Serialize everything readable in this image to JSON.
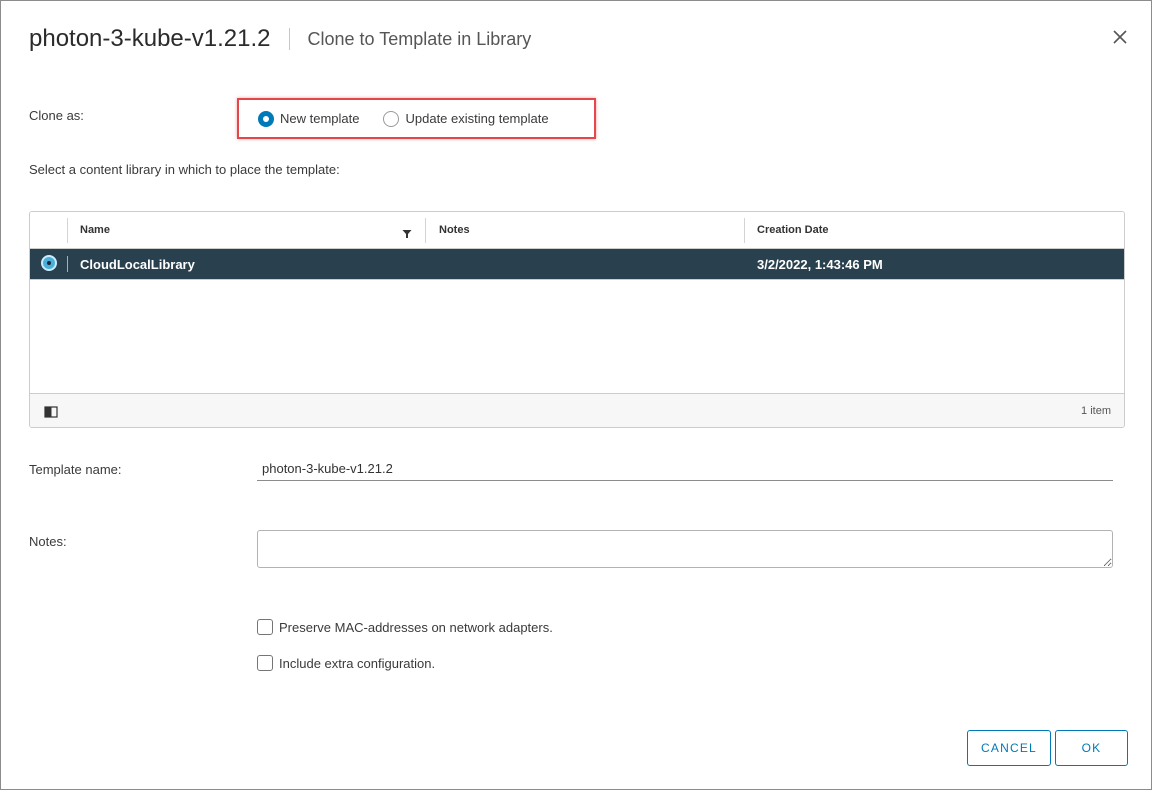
{
  "dialog": {
    "title": "photon-3-kube-v1.21.2",
    "subtitle": "Clone to Template in Library"
  },
  "clone_as": {
    "label": "Clone as:",
    "options": [
      {
        "label": "New template",
        "selected": true
      },
      {
        "label": "Update existing template",
        "selected": false
      }
    ]
  },
  "library_prompt": "Select a content library in which to place the template:",
  "library_grid": {
    "columns": [
      "Name",
      "Notes",
      "Creation Date"
    ],
    "rows": [
      {
        "name": "CloudLocalLibrary",
        "notes": "",
        "creation_date": "3/2/2022, 1:43:46 PM",
        "selected": true
      }
    ],
    "item_count": "1 item"
  },
  "template_name": {
    "label": "Template name:",
    "value": "photon-3-kube-v1.21.2"
  },
  "notes": {
    "label": "Notes:",
    "value": ""
  },
  "options": [
    {
      "label": "Preserve MAC-addresses on network adapters.",
      "checked": false
    },
    {
      "label": "Include extra configuration.",
      "checked": false
    }
  ],
  "buttons": {
    "cancel": "CANCEL",
    "ok": "OK"
  },
  "colors": {
    "accent": "#0079b8",
    "selected_row": "#29414e",
    "highlight_box": "#e4474a"
  }
}
